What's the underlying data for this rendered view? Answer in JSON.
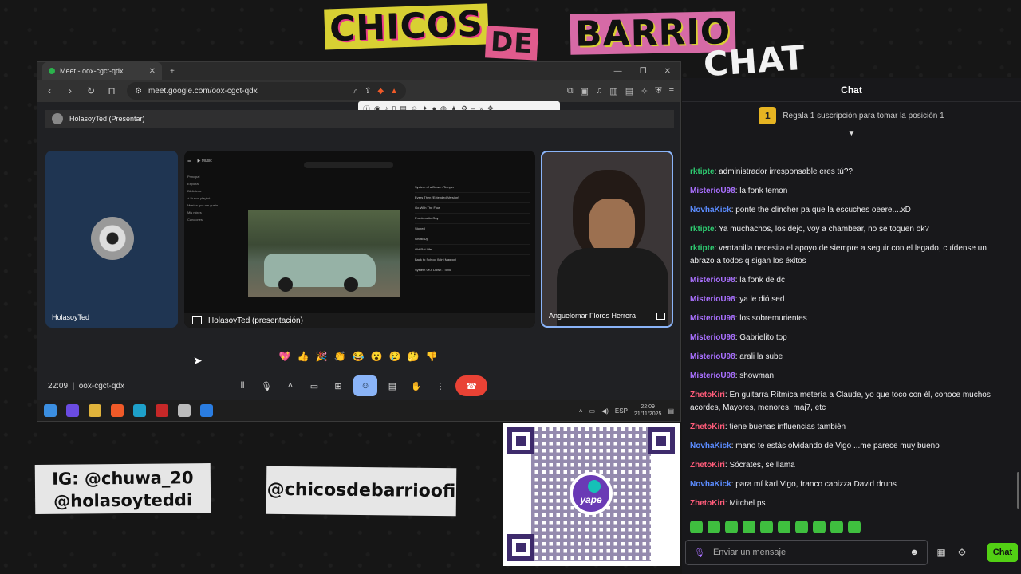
{
  "logo": {
    "word1": "CHICOS",
    "word2": "DE",
    "word3": "BARRIO",
    "chat_label": "CHAT"
  },
  "browser": {
    "tab_title": "Meet - oox-cgct-qdx",
    "url": "meet.google.com/oox-cgct-qdx",
    "presenting_label": "HolasoyTed (Presentar)",
    "tiles": {
      "ted_name": "HolasoyTed",
      "share_name": "HolasoyTed (presentación)",
      "cam_name": "Anguelomar Flores Herrera"
    },
    "yt": {
      "sidebar": [
        "Principal",
        "Explorar",
        "Biblioteca",
        "+ Nueva playlist",
        "Música que me gusta",
        "Mis mixes",
        "Canciones"
      ],
      "queue": [
        "System of a Down - Temper",
        "Evers Then (Extended Version)",
        "Go With The Flow",
        "Problematic Guy",
        "Stoned",
        "Ghost Up",
        "Old Rat Life",
        "Back to School (Mini Maggot)",
        "System Of A Down - Toxic"
      ]
    },
    "reactions": [
      "💖",
      "👍",
      "🎉",
      "👏",
      "😂",
      "😮",
      "😢",
      "🤔",
      "👎"
    ],
    "meeting_time": "22:09",
    "meeting_code": "oox-cgct-qdx",
    "taskbar": {
      "lang": "ESP",
      "time": "22:09",
      "date": "21/11/2025"
    }
  },
  "handles": {
    "ig_line1": "IG: @chuwa_20",
    "ig_line2": "@holasoyteddi",
    "main": "@chicosdebarrioofi"
  },
  "qr": {
    "brand": "yape"
  },
  "chat": {
    "title": "Chat",
    "promo": "Regala 1 suscripción para tomar la posición 1",
    "promo_rank": "1",
    "messages": [
      {
        "user": "rktipte",
        "color": "#2ecc71",
        "text": "administrador irresponsable eres tú??"
      },
      {
        "user": "MisterioU98",
        "color": "#a970ff",
        "text": "la fonk temon"
      },
      {
        "user": "NovhaKick",
        "color": "#5b8cff",
        "text": "ponte the clincher pa que la escuches oeere....xD"
      },
      {
        "user": "rktipte",
        "color": "#2ecc71",
        "text": "Ya muchachos, los dejo, voy a chambear, no se toquen ok?"
      },
      {
        "user": "rktipte",
        "color": "#2ecc71",
        "text": "ventanilla necesita el apoyo de siempre a seguir con el legado, cuídense un abrazo a todos q sigan los éxitos"
      },
      {
        "user": "MisterioU98",
        "color": "#a970ff",
        "text": "la fonk de dc"
      },
      {
        "user": "MisterioU98",
        "color": "#a970ff",
        "text": "ya le dió sed"
      },
      {
        "user": "MisterioU98",
        "color": "#a970ff",
        "text": "los sobremurientes"
      },
      {
        "user": "MisterioU98",
        "color": "#a970ff",
        "text": "Gabrielito top"
      },
      {
        "user": "MisterioU98",
        "color": "#a970ff",
        "text": "arali la sube"
      },
      {
        "user": "MisterioU98",
        "color": "#a970ff",
        "text": "showman"
      },
      {
        "user": "ZhetoKiri",
        "color": "#ff5c7a",
        "text": "En guitarra Rítmica metería a Claude, yo que toco con él, conoce muchos acordes, Mayores, menores, maj7, etc"
      },
      {
        "user": "ZhetoKiri",
        "color": "#ff5c7a",
        "text": "tiene buenas influencias también"
      },
      {
        "user": "NovhaKick",
        "color": "#5b8cff",
        "text": "mano te estás olvidando de Vigo ...me parece muy bueno"
      },
      {
        "user": "ZhetoKiri",
        "color": "#ff5c7a",
        "text": "Sócrates, se llama"
      },
      {
        "user": "NovhaKick",
        "color": "#5b8cff",
        "text": "para mí karl,Vigo, franco cabizza David druns"
      },
      {
        "user": "ZhetoKiri",
        "color": "#ff5c7a",
        "text": "Mitchel ps"
      }
    ],
    "input_placeholder": "Enviar un mensaje",
    "send_label": "Chat"
  }
}
